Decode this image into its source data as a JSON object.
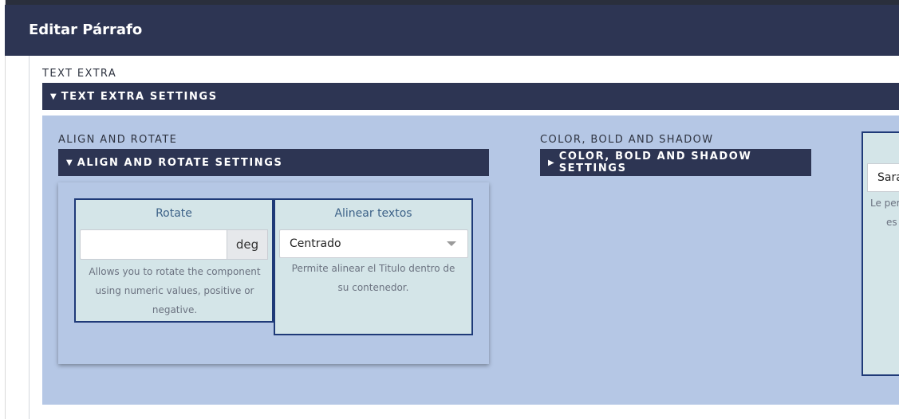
{
  "header": {
    "title": "Editar Párrafo"
  },
  "text_extra": {
    "label": "TEXT EXTRA",
    "settings_bar": "TEXT EXTRA SETTINGS",
    "expanded_icon": "▼"
  },
  "align_rotate": {
    "label": "ALIGN AND ROTATE",
    "settings_bar": "ALIGN AND ROTATE SETTINGS",
    "expanded_icon": "▼",
    "rotate": {
      "title": "Rotate",
      "value": "",
      "unit": "deg",
      "help": "Allows you to rotate the component using numeric values, positive or negative."
    },
    "align": {
      "title": "Alinear textos",
      "selected": "Centrado",
      "help": "Permite alinear el Titulo dentro de su contenedor."
    }
  },
  "color_bold_shadow": {
    "label": "COLOR, BOLD AND SHADOW",
    "settings_bar": "COLOR, BOLD AND SHADOW SETTINGS",
    "collapsed_icon": "▶"
  },
  "partial_card": {
    "input_value": "Sara",
    "help_line1": "Le per",
    "help_line2": "es"
  },
  "colors": {
    "header_bg": "#2d3553",
    "panel_bg": "#b5c7e5",
    "card_bg": "#d4e5e8",
    "card_border": "#1f3a78"
  }
}
